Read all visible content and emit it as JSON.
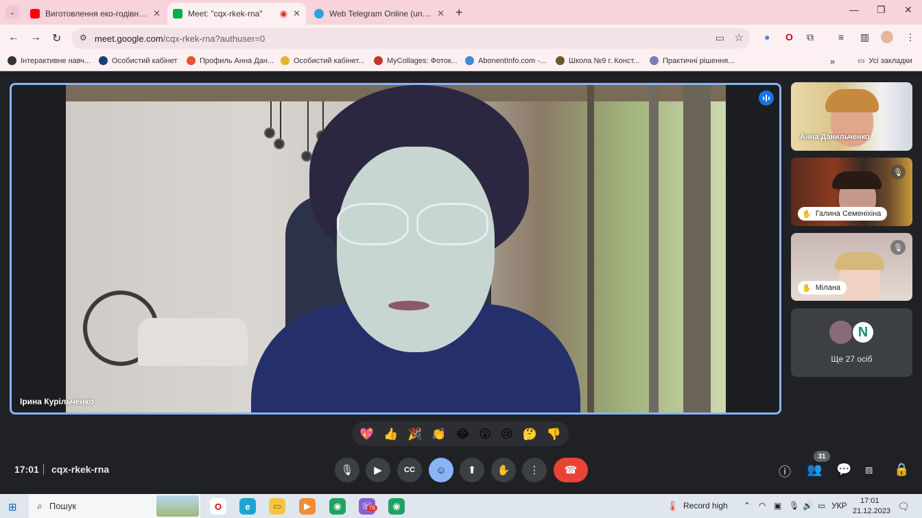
{
  "browser": {
    "tab_list_icon": "chevron-down-icon",
    "tabs": [
      {
        "title": "Виготовлення еко-годівнички",
        "favicon_color": "#ff0000",
        "favicon": "youtube-icon"
      },
      {
        "title": "Meet: \"cqx-rkek-rna\"",
        "favicon_color": "#00ac47",
        "favicon": "meet-icon",
        "recording_indicator": "record-dot-icon"
      },
      {
        "title": "Web Telegram Online (unofficial)",
        "favicon_color": "#2aa3df",
        "favicon": "telegram-icon"
      }
    ],
    "new_tab_label": "+",
    "address_bar": {
      "host": "meet.google.com",
      "path": "/cqx-rkek-rna?authuser=0"
    },
    "bookmarks": [
      {
        "label": "Інтерактивне навч...",
        "color": "#333333"
      },
      {
        "label": "Особистий кабінет",
        "color": "#1a3d7c"
      },
      {
        "label": "Профиль Анна Дан...",
        "color": "#e8552b"
      },
      {
        "label": "Особистий кабінет...",
        "color": "#e3b32b"
      },
      {
        "label": "MyCollages: Фоток...",
        "color": "#c0392b"
      },
      {
        "label": "AbonentInfo.com -...",
        "color": "#3d8bd6"
      },
      {
        "label": "Школа №9 г. Конст...",
        "color": "#6b5a2c"
      },
      {
        "label": "Практичні рішення...",
        "color": "#7a7fb3"
      }
    ],
    "all_bookmarks_label": "Усі закладки"
  },
  "meet": {
    "main_speaker": {
      "name": "Ірина Курільченко"
    },
    "participants": [
      {
        "name": "Анна Данильченко",
        "hand_raised": false,
        "muted": false
      },
      {
        "name": "Галина Семеніхіна",
        "hand_raised": true,
        "muted": true
      },
      {
        "name": "Мілана",
        "hand_raised": true,
        "muted": true
      }
    ],
    "more_participants": {
      "label": "Ще 27 осіб",
      "avatar_letter": "N"
    },
    "reactions": [
      "💖",
      "👍",
      "🎉",
      "👏",
      "😂",
      "😮",
      "😢",
      "🤔",
      "👎"
    ],
    "time": "17:01",
    "meeting_code": "cqx-rkek-rna",
    "participant_count": "31",
    "colors": {
      "accent": "#8ab4f8",
      "end_call": "#ea4335",
      "background": "#202124"
    }
  },
  "taskbar": {
    "search_label": "Пошук",
    "weather_label": "Record high",
    "language": "УКР",
    "time": "17:01",
    "date": "21.12.2023",
    "chrome_badge": "76"
  }
}
